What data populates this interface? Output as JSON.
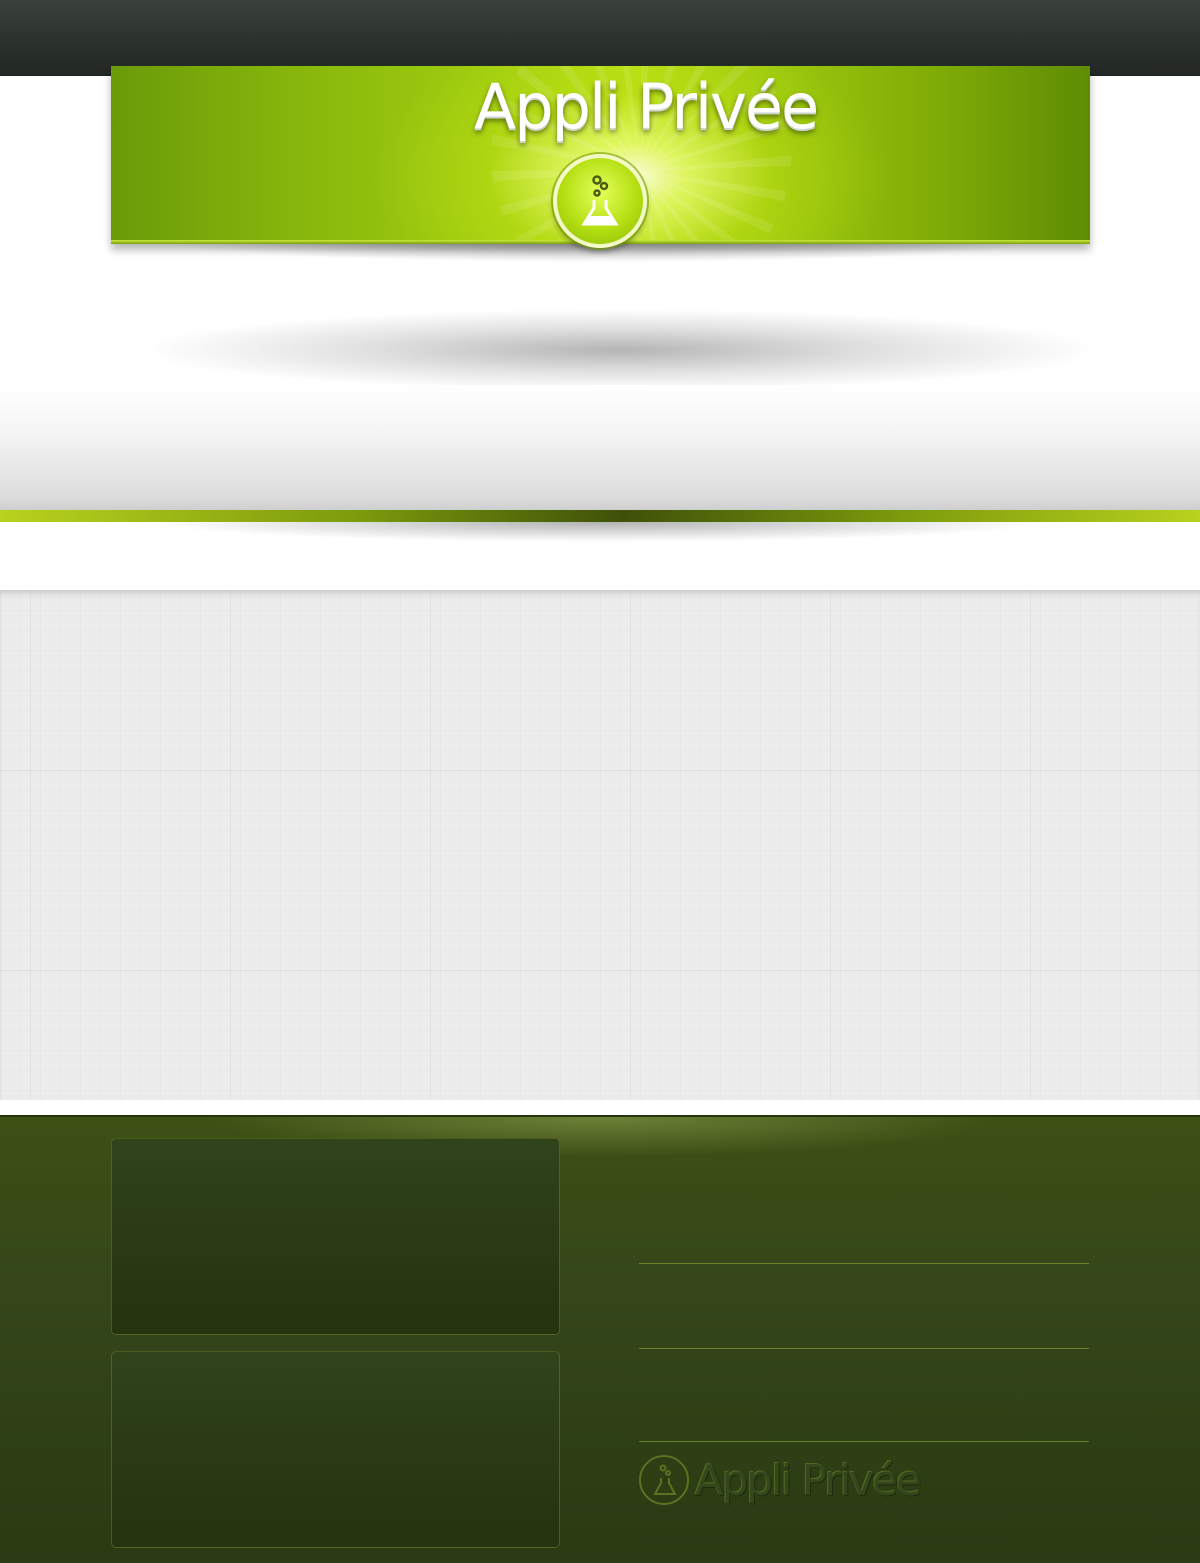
{
  "header": {
    "brand_title": "Appli Privée",
    "logo_icon": "flask-icon"
  },
  "footer": {
    "brand_wordmark": "Appli Privée",
    "logo_icon": "flask-icon"
  },
  "colors": {
    "brand_green": "#a2cf10",
    "dark_topbar": "#2b312d",
    "footer_olive": "#34461a",
    "grid_gray": "#ececec"
  }
}
